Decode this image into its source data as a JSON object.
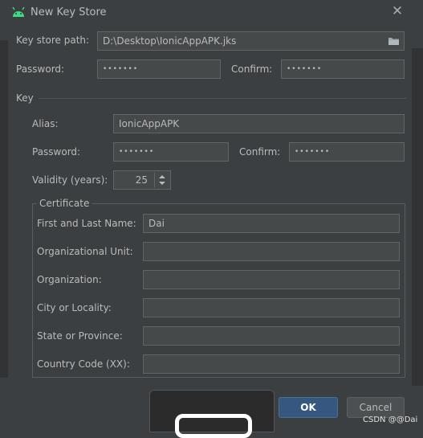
{
  "window": {
    "title": "New Key Store",
    "close_symbol": "✕"
  },
  "keystore": {
    "path_label": "Key store path:",
    "path_value": "D:\\Desktop\\IonicAppAPK.jks",
    "folder_icon": "folder-icon",
    "password_label": "Password:",
    "password_value": "•••••••",
    "confirm_label": "Confirm:",
    "confirm_value": "•••••••"
  },
  "key": {
    "group_label": "Key",
    "alias_label": "Alias:",
    "alias_value": "IonicAppAPK",
    "password_label": "Password:",
    "password_value": "•••••••",
    "confirm_label": "Confirm:",
    "confirm_value": "•••••••",
    "validity_label": "Validity (years):",
    "validity_value": "25"
  },
  "certificate": {
    "group_label": "Certificate",
    "fields": [
      {
        "label": "First and Last Name:",
        "value": "Dai"
      },
      {
        "label": "Organizational Unit:",
        "value": ""
      },
      {
        "label": "Organization:",
        "value": ""
      },
      {
        "label": "City or Locality:",
        "value": ""
      },
      {
        "label": "State or Province:",
        "value": ""
      },
      {
        "label": "Country Code (XX):",
        "value": ""
      }
    ]
  },
  "buttons": {
    "ok": "OK",
    "cancel": "Cancel"
  },
  "watermark": "CSDN @@Dai",
  "colors": {
    "accent_ok": "#365880",
    "android_green": "#3ddc84"
  }
}
